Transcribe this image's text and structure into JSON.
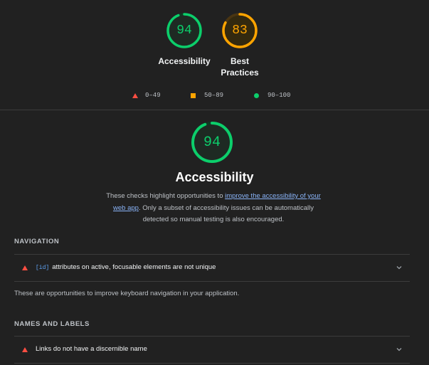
{
  "colors": {
    "pass": "#0cce6b",
    "average": "#ffa400",
    "fail": "#ff4e42",
    "link": "#8ab4f8"
  },
  "summary": {
    "gauges": [
      {
        "score": "94",
        "label": "Accessibility",
        "level": "pass"
      },
      {
        "score": "83",
        "label": "Best Practices",
        "level": "average"
      }
    ]
  },
  "legend": {
    "fail": "0–49",
    "average": "50–89",
    "pass": "90–100"
  },
  "category": {
    "score": "94",
    "title": "Accessibility",
    "desc_prefix": "These checks highlight opportunities to ",
    "desc_link": "improve the accessibility of your web app",
    "desc_suffix": ". Only a subset of accessibility issues can be automatically detected so manual testing is also encouraged."
  },
  "groups": [
    {
      "title": "NAVIGATION",
      "audit": {
        "code": "[id]",
        "text": "attributes on active, focusable elements are not unique"
      },
      "description": "These are opportunities to improve keyboard navigation in your application."
    },
    {
      "title": "NAMES AND LABELS",
      "audit": {
        "code": "",
        "text": "Links do not have a discernible name"
      }
    }
  ]
}
